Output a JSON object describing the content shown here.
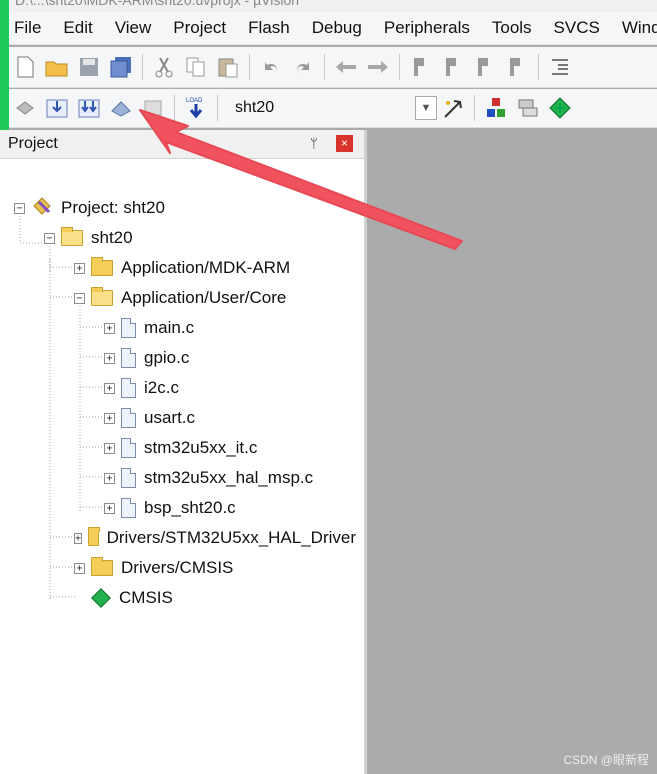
{
  "window": {
    "title": "D:\\...\\sht20\\MDK-ARM\\sht20.uvprojx - µVision"
  },
  "menu": [
    "File",
    "Edit",
    "View",
    "Project",
    "Flash",
    "Debug",
    "Peripherals",
    "Tools",
    "SVCS",
    "Wind"
  ],
  "toolbar2": {
    "target": "sht20",
    "load_icon_text": "LOAD"
  },
  "panel": {
    "title": "Project",
    "pin": "ᛘ",
    "close": "×"
  },
  "tree": {
    "root": "Project: sht20",
    "target": "sht20",
    "groups": [
      {
        "label": "Application/MDK-ARM",
        "expanded": false
      },
      {
        "label": "Application/User/Core",
        "expanded": true
      },
      {
        "label": "Drivers/STM32U5xx_HAL_Driver",
        "expanded": false
      },
      {
        "label": "Drivers/CMSIS",
        "expanded": false
      }
    ],
    "files": [
      "main.c",
      "gpio.c",
      "i2c.c",
      "usart.c",
      "stm32u5xx_it.c",
      "stm32u5xx_hal_msp.c",
      "bsp_sht20.c"
    ],
    "cmsis": "CMSIS"
  },
  "colors": {
    "arrow": "#f0535e",
    "close": "#d9342b",
    "strip": "#1fc85a"
  },
  "watermark": "CSDN @眼新程"
}
